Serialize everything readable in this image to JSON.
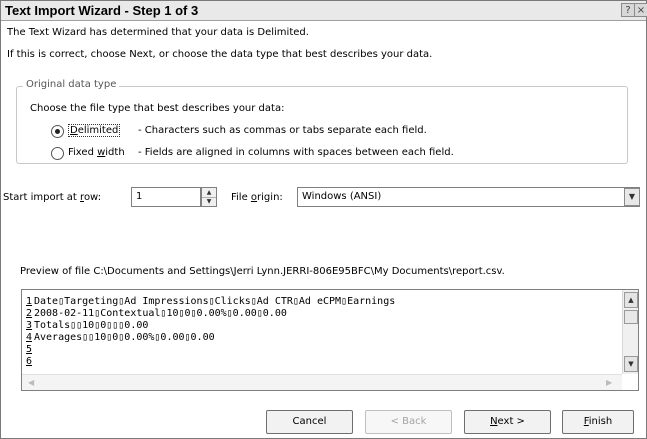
{
  "window": {
    "title": "Text Import Wizard - Step 1 of 3",
    "help_glyph": "?",
    "close_glyph": "×"
  },
  "intro": {
    "line1": "The Text Wizard has determined that your data is Delimited.",
    "line2": "If this is correct, choose Next, or choose the data type that best describes your data."
  },
  "original_data_type": {
    "legend": "Original data type",
    "prompt": "Choose the file type that best describes your data:",
    "options": [
      {
        "label_pre": "",
        "label_acc": "D",
        "label_post": "elimited",
        "description": "- Characters such as commas or tabs separate each field.",
        "selected": true
      },
      {
        "label_pre": "Fixed ",
        "label_acc": "w",
        "label_post": "idth",
        "description": "- Fields are aligned in columns with spaces between each field.",
        "selected": false
      }
    ]
  },
  "start_row": {
    "label_pre": "Start import at ",
    "label_acc": "r",
    "label_post": "ow:",
    "value": "1"
  },
  "file_origin": {
    "label_pre": "File ",
    "label_acc": "o",
    "label_post": "rigin:",
    "value": "Windows (ANSI)"
  },
  "preview": {
    "caption": "Preview of file C:\\Documents and Settings\\Jerri Lynn.JERRI-806E95BFC\\My Documents\\report.csv.",
    "rows": [
      {
        "num": "1",
        "text": "Date▯Targeting▯Ad Impressions▯Clicks▯Ad CTR▯Ad eCPM▯Earnings"
      },
      {
        "num": "2",
        "text": "2008-02-11▯Contextual▯10▯0▯0.00%▯0.00▯0.00"
      },
      {
        "num": "3",
        "text": "Totals▯▯10▯0▯▯▯0.00"
      },
      {
        "num": "4",
        "text": "Averages▯▯10▯0▯0.00%▯0.00▯0.00"
      },
      {
        "num": "5",
        "text": ""
      },
      {
        "num": "6",
        "text": ""
      }
    ]
  },
  "buttons": {
    "cancel": "Cancel",
    "back": "< Back",
    "next_acc": "N",
    "next_post": "ext >",
    "finish_acc": "F",
    "finish_post": "inish"
  }
}
